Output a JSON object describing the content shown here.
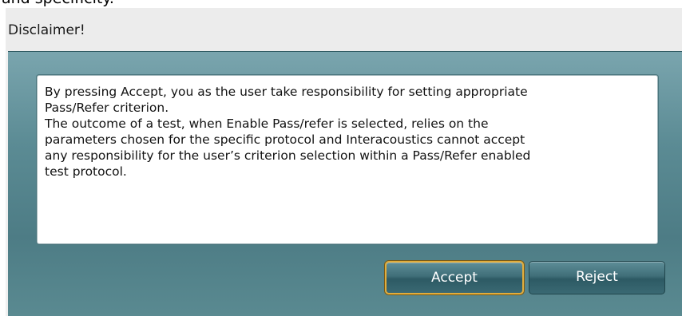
{
  "header_fragment": "and specificity.",
  "dialog": {
    "title": "Disclaimer!",
    "message_lines": [
      "By pressing Accept, you as the user take responsibility for setting appropriate",
      "Pass/Refer criterion.",
      "The outcome of a test, when Enable Pass/refer is selected, relies on the",
      "parameters chosen for the specific protocol and Interacoustics cannot accept",
      "any responsibility for the user’s criterion selection within a Pass/Refer enabled",
      "test protocol."
    ],
    "buttons": {
      "accept_label": "Accept",
      "reject_label": "Reject"
    }
  },
  "colors": {
    "client_teal": "#5b8b94",
    "button_teal": "#3f6e78",
    "focus_ring": "#e2ad3c"
  }
}
